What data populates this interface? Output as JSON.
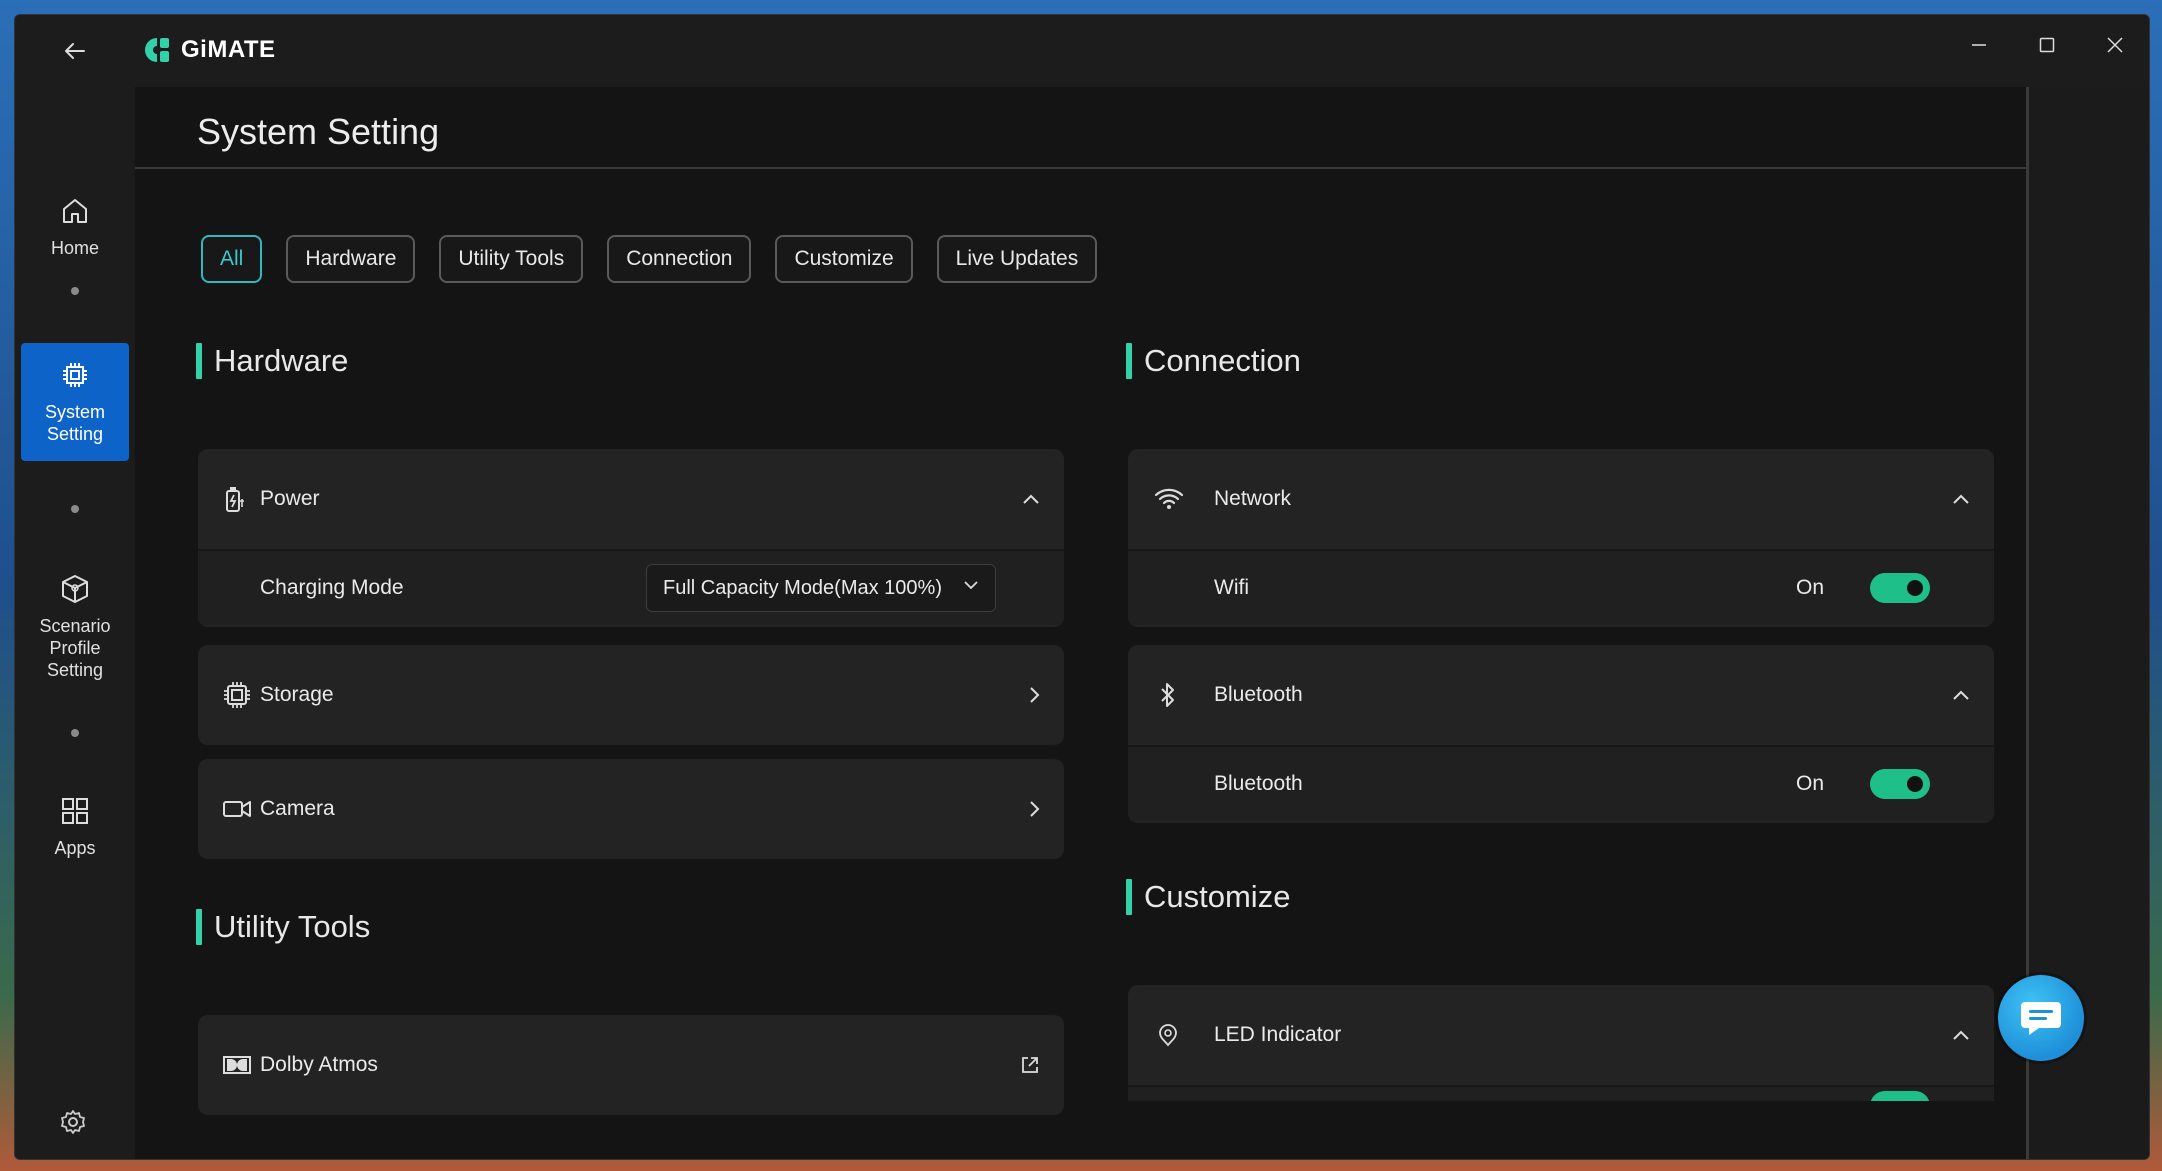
{
  "app": {
    "name": "GiMATE"
  },
  "colors": {
    "accent": "#33d1a8",
    "active_nav": "#0e63c8",
    "chip_active": "#38c9d0",
    "toggle_on": "#1fbf8a"
  },
  "sidebar": {
    "items": [
      {
        "label": "Home",
        "icon": "home-icon"
      },
      {
        "label": "System Setting",
        "icon": "chip-icon",
        "active": true
      },
      {
        "label": "Scenario Profile Setting",
        "icon": "cube-icon"
      },
      {
        "label": "Apps",
        "icon": "grid-icon"
      }
    ]
  },
  "page": {
    "title": "System Setting"
  },
  "filters": [
    "All",
    "Hardware",
    "Utility Tools",
    "Connection",
    "Customize",
    "Live Updates"
  ],
  "hardware": {
    "title": "Hardware",
    "power": {
      "label": "Power",
      "charging_label": "Charging Mode",
      "charging_value": "Full Capacity Mode(Max 100%)"
    },
    "storage": {
      "label": "Storage"
    },
    "camera": {
      "label": "Camera"
    }
  },
  "utility": {
    "title": "Utility Tools",
    "dolby": {
      "label": "Dolby Atmos"
    }
  },
  "connection": {
    "title": "Connection",
    "network": {
      "label": "Network",
      "wifi_label": "Wifi",
      "wifi_state": "On"
    },
    "bluetooth": {
      "label": "Bluetooth",
      "bt_label": "Bluetooth",
      "bt_state": "On"
    }
  },
  "customize": {
    "title": "Customize",
    "led": {
      "label": "LED Indicator"
    }
  }
}
